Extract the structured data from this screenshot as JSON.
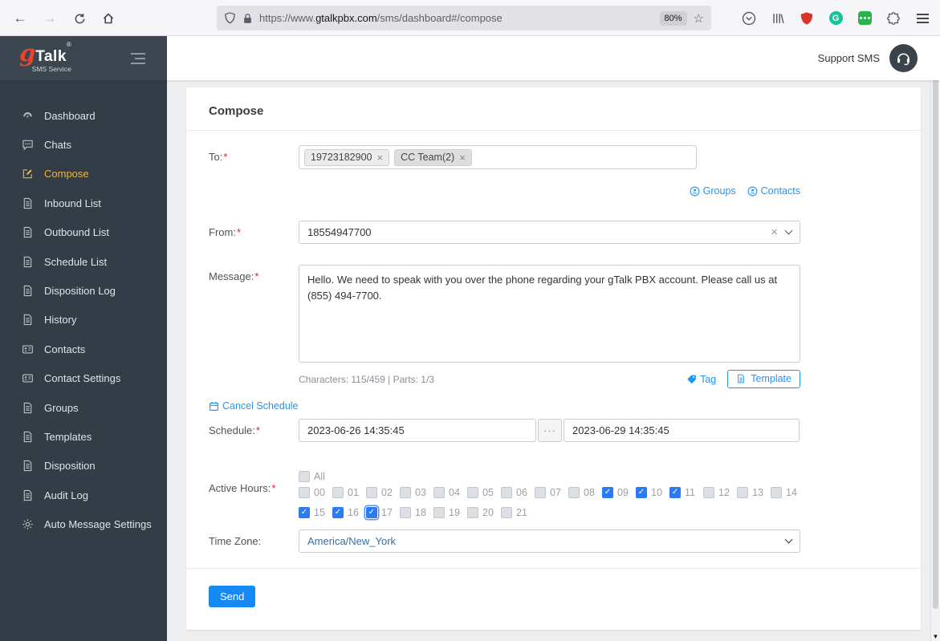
{
  "colors": {
    "accent_blue": "#2196f3",
    "send_button_blue": "#1789f2",
    "sidebar_active_yellow": "#f2b33d",
    "checked_checkbox_blue": "#2b7bf3",
    "logo_red": "#e8432c",
    "sidebar_bg": "#323d48"
  },
  "browser": {
    "url_prefix": "https://www.",
    "url_domain": "gtalkpbx.com",
    "url_path": "/sms/dashboard#/compose",
    "zoom_badge": "80%"
  },
  "header": {
    "logo_g": "g",
    "logo_talk": "Talk",
    "logo_reg": "®",
    "logo_sub": "SMS Service",
    "support_label": "Support SMS"
  },
  "sidebar": {
    "items": [
      {
        "label": "Dashboard",
        "icon": "gauge",
        "active": false
      },
      {
        "label": "Chats",
        "icon": "chat",
        "active": false
      },
      {
        "label": "Compose",
        "icon": "compose",
        "active": true
      },
      {
        "label": "Inbound List",
        "icon": "doc",
        "active": false
      },
      {
        "label": "Outbound List",
        "icon": "doc",
        "active": false
      },
      {
        "label": "Schedule List",
        "icon": "doc",
        "active": false
      },
      {
        "label": "Disposition Log",
        "icon": "doc",
        "active": false
      },
      {
        "label": "History",
        "icon": "doc",
        "active": false
      },
      {
        "label": "Contacts",
        "icon": "card",
        "active": false
      },
      {
        "label": "Contact Settings",
        "icon": "card",
        "active": false
      },
      {
        "label": "Groups",
        "icon": "doc",
        "active": false
      },
      {
        "label": "Templates",
        "icon": "doc",
        "active": false
      },
      {
        "label": "Disposition",
        "icon": "doc",
        "active": false
      },
      {
        "label": "Audit Log",
        "icon": "doc",
        "active": false
      },
      {
        "label": "Auto Message Settings",
        "icon": "gear",
        "active": false
      }
    ]
  },
  "compose": {
    "title": "Compose",
    "required_marker": "*",
    "to": {
      "label": "To:",
      "chips": [
        "19723182900",
        "CC Team(2)"
      ],
      "groups_link": "Groups",
      "contacts_link": "Contacts"
    },
    "from": {
      "label": "From:",
      "value": "18554947700"
    },
    "message": {
      "label": "Message:",
      "value": "Hello. We need to speak with you over the phone regarding your gTalk PBX account. Please call us at (855) 494-7700.",
      "counter": "Characters: 115/459 | Parts: 1/3",
      "tag_link": "Tag",
      "template_button": "Template"
    },
    "schedule": {
      "cancel_link": "Cancel Schedule",
      "label": "Schedule:",
      "start": "2023-06-26 14:35:45",
      "separator": "···",
      "end": "2023-06-29 14:35:45"
    },
    "active_hours": {
      "label": "Active Hours:",
      "all_label": "All",
      "all_checked": false,
      "hours": [
        "00",
        "01",
        "02",
        "03",
        "04",
        "05",
        "06",
        "07",
        "08",
        "09",
        "10",
        "11",
        "12",
        "13",
        "14",
        "15",
        "16",
        "17",
        "18",
        "19",
        "20",
        "21"
      ],
      "checked": [
        "09",
        "10",
        "11",
        "15",
        "16",
        "17"
      ],
      "focused": "17"
    },
    "timezone": {
      "label": "Time Zone:",
      "value": "America/New_York"
    },
    "send_button": "Send"
  }
}
